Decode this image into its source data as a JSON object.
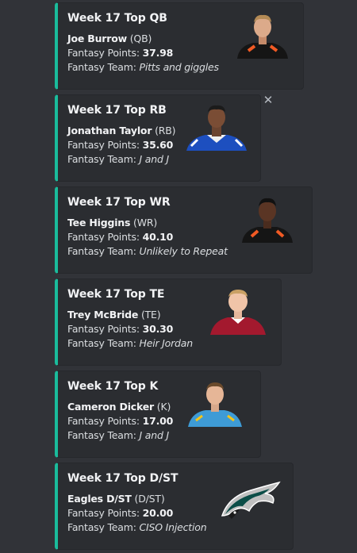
{
  "cards": [
    {
      "title": "Week 17 Top QB",
      "player": "Joe Burrow",
      "pos": "(QB)",
      "points_label": "Fantasy Points: ",
      "points": "37.98",
      "team_label": "Fantasy Team: ",
      "team": "Pitts and giggles",
      "thumb_icon": "player-headshot-bengals"
    },
    {
      "title": "Week 17 Top RB",
      "player": "Jonathan Taylor",
      "pos": "(RB)",
      "points_label": "Fantasy Points: ",
      "points": "35.60",
      "team_label": "Fantasy Team: ",
      "team": "J and J",
      "thumb_icon": "player-headshot-colts"
    },
    {
      "title": "Week 17 Top WR",
      "player": "Tee Higgins",
      "pos": "(WR)",
      "points_label": "Fantasy Points: ",
      "points": "40.10",
      "team_label": "Fantasy Team: ",
      "team": "Unlikely to Repeat",
      "thumb_icon": "player-headshot-bengals"
    },
    {
      "title": "Week 17 Top TE",
      "player": "Trey McBride",
      "pos": "(TE)",
      "points_label": "Fantasy Points: ",
      "points": "30.30",
      "team_label": "Fantasy Team: ",
      "team": "Heir Jordan",
      "thumb_icon": "player-headshot-cardinals"
    },
    {
      "title": "Week 17 Top K",
      "player": "Cameron Dicker",
      "pos": "(K)",
      "points_label": "Fantasy Points: ",
      "points": "17.00",
      "team_label": "Fantasy Team: ",
      "team": "J and J",
      "thumb_icon": "player-headshot-chargers"
    },
    {
      "title": "Week 17 Top D/ST",
      "player": "Eagles D/ST",
      "pos": "(D/ST)",
      "points_label": "Fantasy Points: ",
      "points": "20.00",
      "team_label": "Fantasy Team: ",
      "team": "CISO Injection",
      "thumb_icon": "eagles-logo"
    }
  ],
  "close_icon": "close-icon",
  "colors": {
    "accent": "#1abc9c",
    "background": "#313338",
    "card": "#2b2d31"
  }
}
